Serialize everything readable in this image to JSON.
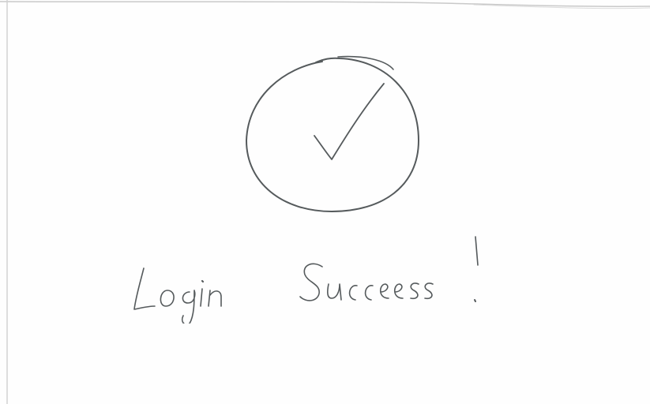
{
  "screen": {
    "status_icon": "check-circle-icon",
    "message": "Login Success!",
    "ink_color": "#555a5c"
  }
}
